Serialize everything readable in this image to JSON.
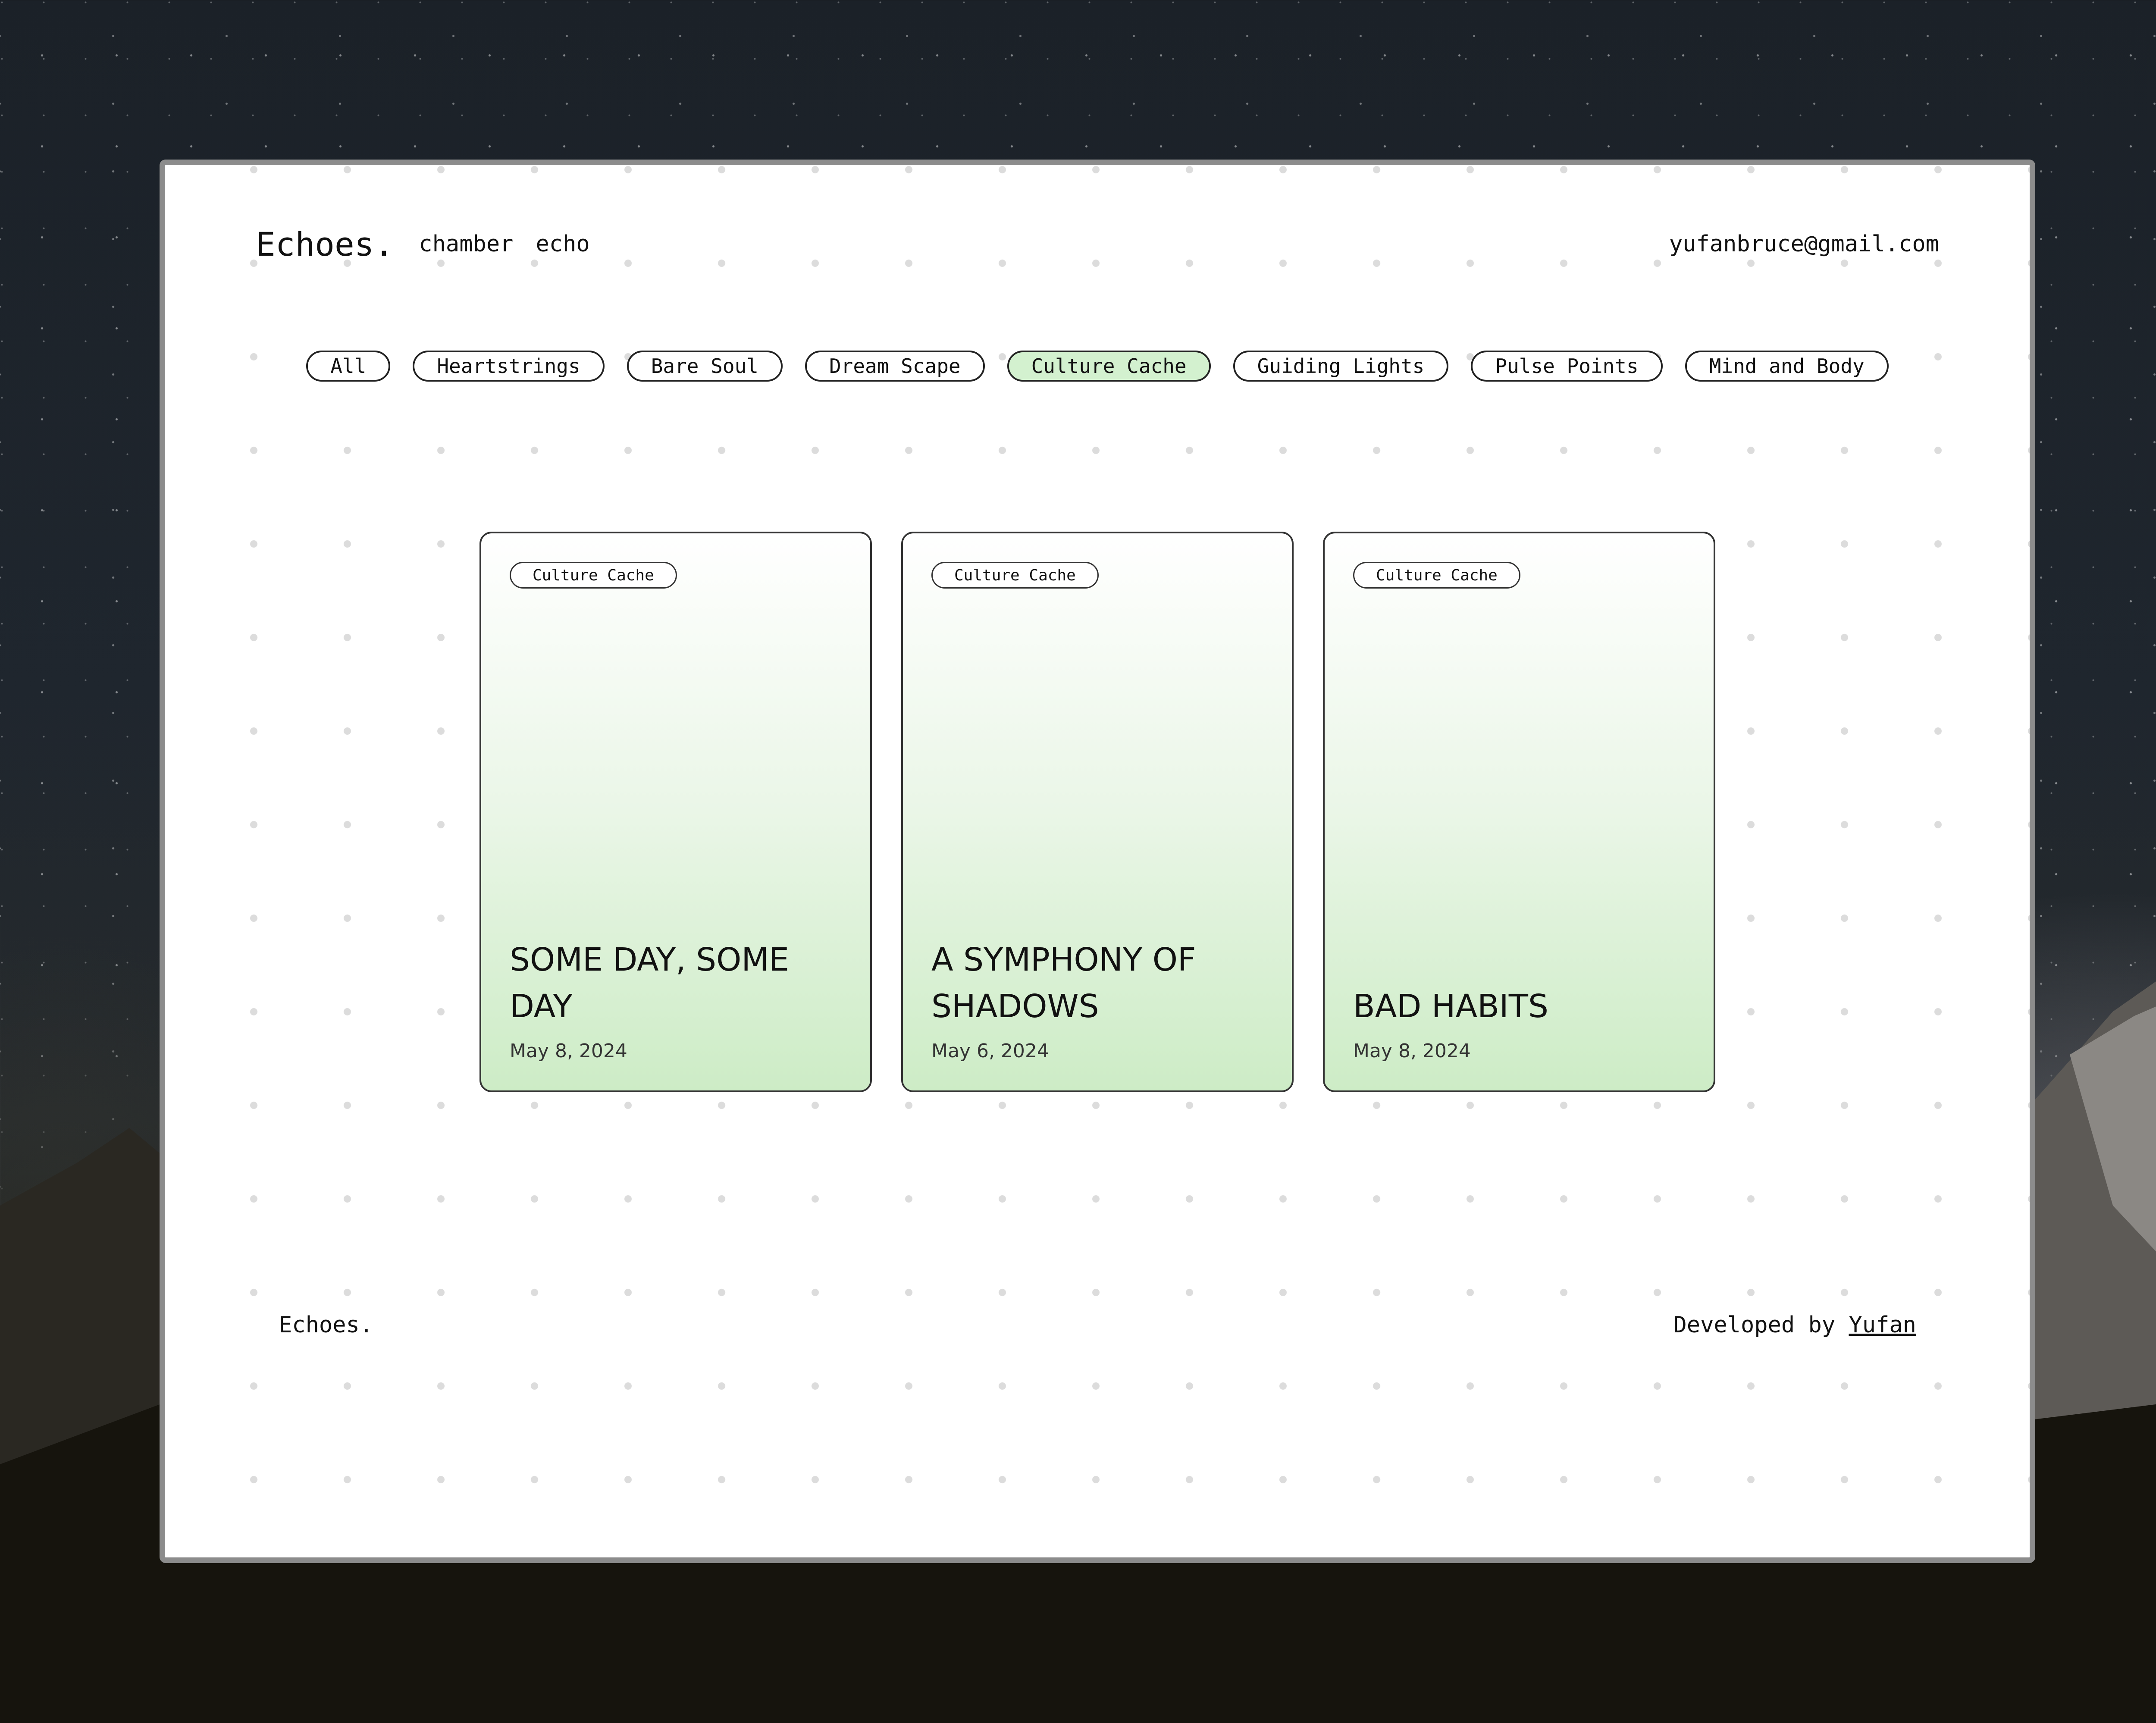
{
  "header": {
    "brand": "Echoes.",
    "nav": [
      {
        "label": "chamber"
      },
      {
        "label": "echo"
      }
    ],
    "email": "yufanbruce@gmail.com"
  },
  "filters": {
    "active": "Culture Cache",
    "items": [
      {
        "label": "All"
      },
      {
        "label": "Heartstrings"
      },
      {
        "label": "Bare Soul"
      },
      {
        "label": "Dream Scape"
      },
      {
        "label": "Culture Cache"
      },
      {
        "label": "Guiding Lights"
      },
      {
        "label": "Pulse Points"
      },
      {
        "label": "Mind and Body"
      }
    ]
  },
  "posts": [
    {
      "tag": "Culture Cache",
      "title": "SOME DAY, SOME DAY",
      "date": "May 8, 2024"
    },
    {
      "tag": "Culture Cache",
      "title": "A SYMPHONY OF SHADOWS",
      "date": "May 6, 2024"
    },
    {
      "tag": "Culture Cache",
      "title": "BAD HABITS",
      "date": "May 8, 2024"
    }
  ],
  "footer": {
    "brand": "Echoes.",
    "developed_by": "Developed by",
    "author": "Yufan"
  },
  "colors": {
    "active_chip": "#d3f1cf",
    "card_gradient_end": "#cdecc6",
    "window_border": "#8c8c8c"
  }
}
